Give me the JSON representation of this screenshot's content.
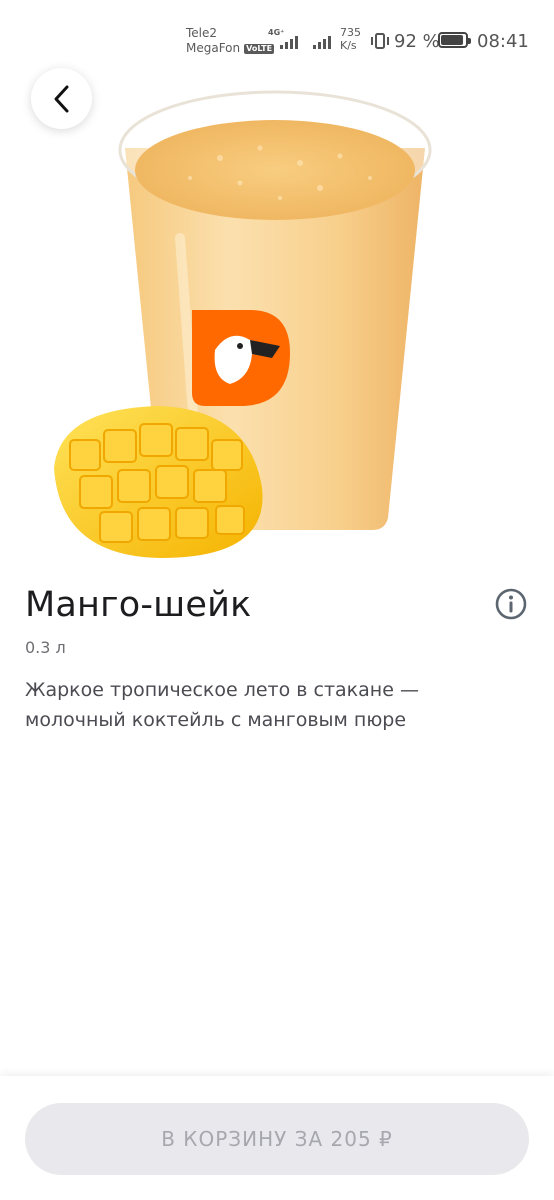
{
  "status_bar": {
    "carrier_1": "Tele2",
    "carrier_2": "MegaFon",
    "volte": "VoLTE",
    "network_type": "4G⁺",
    "speed_value": "735",
    "speed_unit": "K/s",
    "battery_percent": "92 %",
    "battery_level": 0.92,
    "time": "08:41"
  },
  "product": {
    "title": "Манго-шейк",
    "size": "0.3 л",
    "description": "Жаркое тропическое лето в стакане — молочный коктейль с манговым пюре",
    "image_icon": "mango-shake-photo",
    "accent_color": "#ff6900"
  },
  "actions": {
    "back_icon": "chevron-left-icon",
    "info_icon": "info-icon",
    "add_to_cart_label": "В КОРЗИНУ ЗА 205 ₽"
  }
}
